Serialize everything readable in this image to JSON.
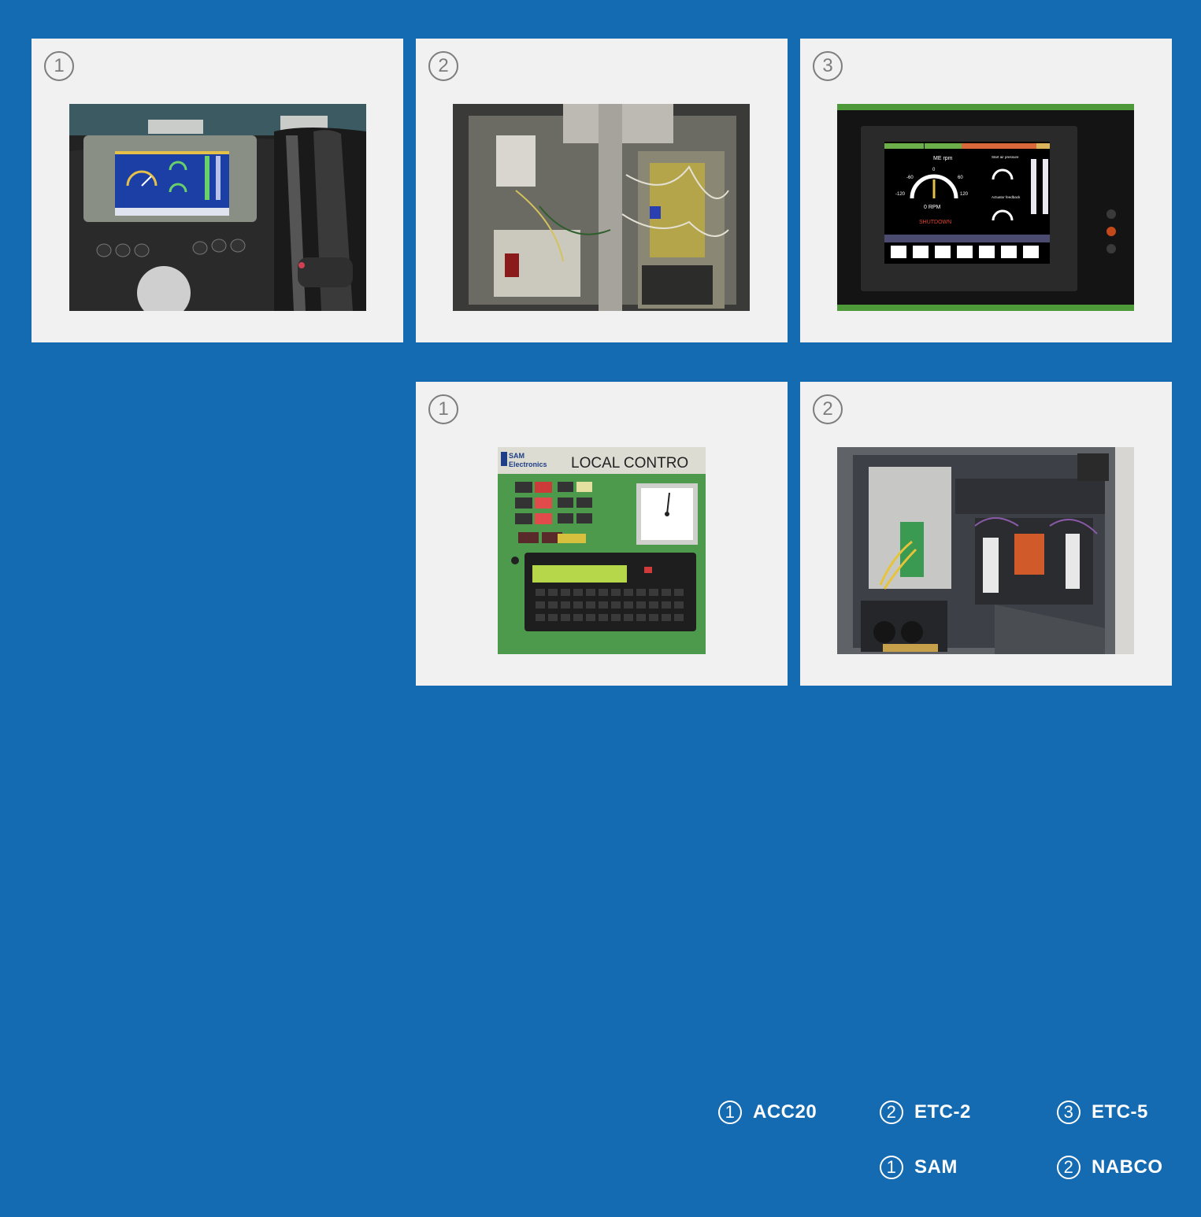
{
  "cards": [
    {
      "badge": "1",
      "photo": "acc20-control-panel-photo"
    },
    {
      "badge": "2",
      "photo": "etc2-cabinet-photo"
    },
    {
      "badge": "3",
      "photo": "etc5-display-photo"
    },
    {
      "badge": "1",
      "photo": "sam-local-control-photo"
    },
    {
      "badge": "2",
      "photo": "nabco-cabinet-photo"
    }
  ],
  "photo_text": {
    "etc5": {
      "title": "ME rpm",
      "rpm": "0 RPM",
      "state": "SHUTDOWN",
      "start_air": "Start air pressure",
      "actuator": "Actuator feedback",
      "tick_m120": "-120",
      "tick_m60": "-60",
      "tick_0": "0",
      "tick_60": "60",
      "tick_120": "120"
    },
    "sam": {
      "brand_line1": "SAM",
      "brand_line2": "Electronics",
      "panel_title": "LOCAL CONTRO"
    }
  },
  "legend": [
    {
      "num": "1",
      "label": "ACC20"
    },
    {
      "num": "2",
      "label": "ETC-2"
    },
    {
      "num": "3",
      "label": "ETC-5"
    },
    {
      "num": "1",
      "label": "SAM"
    },
    {
      "num": "2",
      "label": "NABCO"
    }
  ]
}
